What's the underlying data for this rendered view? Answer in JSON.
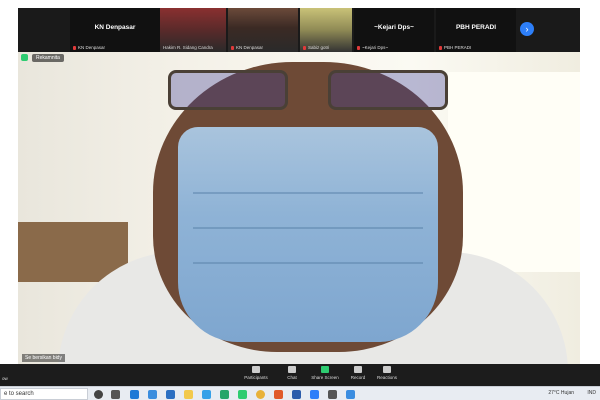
{
  "participants": [
    {
      "name": "KN Denpasar",
      "caption": "KN Denpasar",
      "video": false
    },
    {
      "name": "",
      "caption": "Hakim R. Sidang Candra",
      "video": true
    },
    {
      "name": "",
      "caption": "KN Denpasar",
      "video": true
    },
    {
      "name": "",
      "caption": "Sabiz gotri",
      "video": true
    },
    {
      "name": "~Kejari Dps~",
      "caption": "~Kejari Dps~",
      "video": false
    },
    {
      "name": "PBH PERADI",
      "caption": "PBH PERADI",
      "video": false
    }
  ],
  "next_icon": "chevron-right-icon",
  "main_video": {
    "self_label": "Rekamnita",
    "speaker_label": "Se bersikan bidy"
  },
  "controls": {
    "left_label": "ow",
    "items": [
      {
        "label": "Participants",
        "icon": "participants-icon"
      },
      {
        "label": "Chat",
        "icon": "chat-icon"
      },
      {
        "label": "Share Screen",
        "icon": "share-screen-icon"
      },
      {
        "label": "Record",
        "icon": "record-icon"
      },
      {
        "label": "Reactions",
        "icon": "reactions-icon"
      }
    ]
  },
  "taskbar": {
    "search_placeholder": "e to search",
    "weather": "27°C Hujan",
    "lang": "IND"
  },
  "colors": {
    "accent_blue": "#2d7ff9",
    "share_green": "#2ecc71",
    "mic_red": "#e03a3a"
  }
}
